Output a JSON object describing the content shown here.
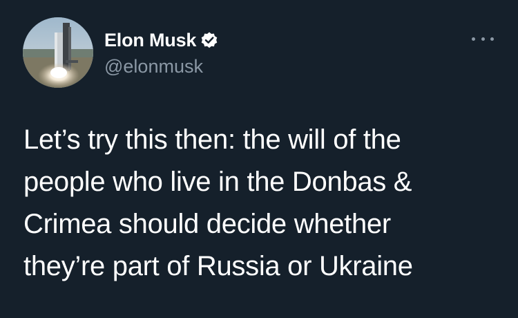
{
  "author": {
    "display_name": "Elon Musk",
    "handle": "@elonmusk",
    "verified": true,
    "avatar": "starship-launch-avatar"
  },
  "menu": {
    "icon": "more-options-icon"
  },
  "tweet": {
    "lines": [
      "Let’s try this then: the will of the",
      "people who live in the Donbas &",
      "Crimea should decide whether",
      "they’re part of Russia or Ukraine"
    ]
  },
  "colors": {
    "background": "#15202b",
    "text": "#ffffff",
    "secondary_text": "#8b98a5",
    "verified_badge": "#ffffff"
  }
}
